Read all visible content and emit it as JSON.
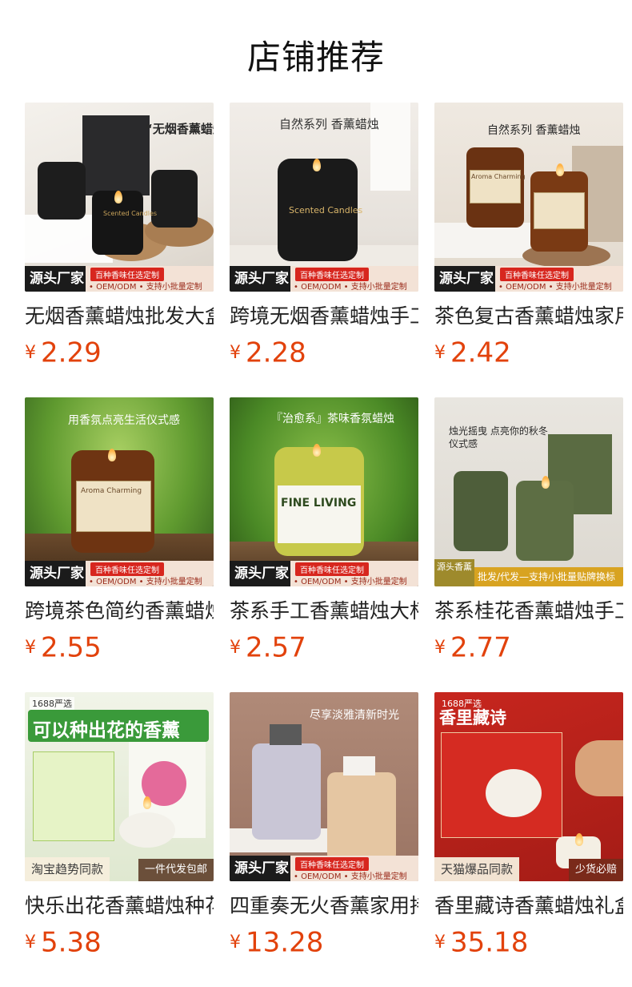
{
  "page": {
    "title": "店铺推荐"
  },
  "colors": {
    "price": "#e2420c",
    "accent_red": "#d7261e"
  },
  "badge": {
    "factory": "源头厂家",
    "custom": "百种香味任选定制",
    "services": "• OEM/ODM • 支持小批量定制"
  },
  "products": [
    {
      "name": "无烟香薰蜡烛批发大盒",
      "currency": "¥",
      "price": "2.29",
      "overlay": "“无烟香薰蜡烛”",
      "jar_label": "Scented Candles"
    },
    {
      "name": "跨境无烟香薰蜡烛手工",
      "currency": "¥",
      "price": "2.28",
      "overlay": "自然系列 香薰蜡烛",
      "jar_label": "Scented Candles"
    },
    {
      "name": "茶色复古香薰蜡烛家用",
      "currency": "¥",
      "price": "2.42",
      "overlay": "自然系列 香薰蜡烛",
      "jar_label": "Aroma Charming"
    },
    {
      "name": "跨境茶色简约香薰蜡烛",
      "currency": "¥",
      "price": "2.55",
      "overlay": "用香氛点亮生活仪式感",
      "jar_label": "Aroma Charming"
    },
    {
      "name": "茶系手工香薰蜡烛大杯",
      "currency": "¥",
      "price": "2.57",
      "overlay": "『治愈系』茶味香氛蜡烛",
      "jar_label": "FINE LIVING"
    },
    {
      "name": "茶系桂花香薰蜡烛手工",
      "currency": "¥",
      "price": "2.77",
      "overlay": "烛光摇曳 点亮你的秋冬仪式感",
      "source_tag": "源头香薰",
      "bar_text": "批发/代发—支持小批量贴牌换标"
    },
    {
      "name": "快乐出花香薰蜡烛种花",
      "currency": "¥",
      "price": "5.38",
      "overlay": "可以种出花的香薰",
      "corner": "1688严选",
      "bottom_left": "淘宝趋势同款",
      "bottom_right": "一件代发包邮"
    },
    {
      "name": "四重奏无火香薰家用持",
      "currency": "¥",
      "price": "13.28",
      "overlay": "尽享淡雅清新时光"
    },
    {
      "name": "香里藏诗香薰蜡烛礼盒",
      "currency": "¥",
      "price": "35.18",
      "overlay": "香里藏诗",
      "corner": "1688严选",
      "bottom_left": "天猫爆品同款",
      "bottom_right": "少货必赔"
    }
  ]
}
